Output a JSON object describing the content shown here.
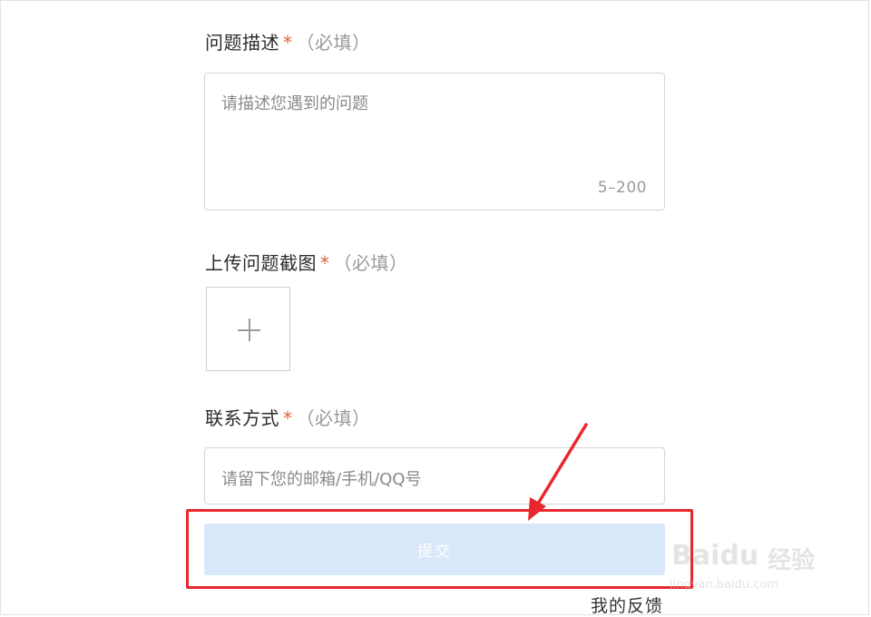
{
  "form": {
    "description": {
      "label": "问题描述",
      "star": "*",
      "required": "（必填）",
      "placeholder": "请描述您遇到的问题",
      "counter": "5–200"
    },
    "screenshot": {
      "label": "上传问题截图",
      "star": "*",
      "required": "（必填）"
    },
    "contact": {
      "label": "联系方式",
      "star": "*",
      "required": "（必填）",
      "placeholder": "请留下您的邮箱/手机/QQ号"
    },
    "submit_label": "提交",
    "my_feedback_label": "我的反馈"
  },
  "watermark": {
    "brand": "Baidu",
    "subtitle": "经验",
    "url": "jingyan.baidu.com"
  },
  "colors": {
    "accent_star": "#e0603e",
    "submit_bg": "#d8e8fa",
    "annotation_red": "#e8282d"
  }
}
